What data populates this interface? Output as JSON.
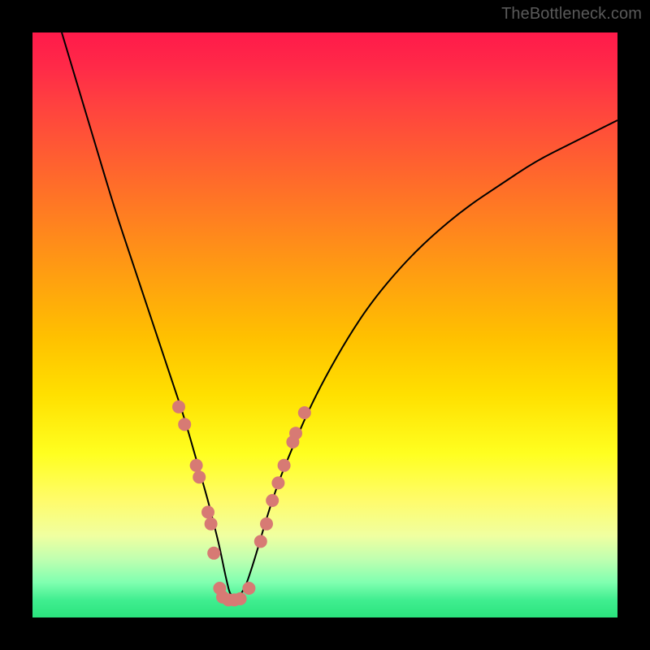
{
  "watermark": {
    "text": "TheBottleneck.com"
  },
  "chart_data": {
    "type": "line",
    "title": "",
    "xlabel": "",
    "ylabel": "",
    "xlim": [
      0,
      100
    ],
    "ylim": [
      0,
      100
    ],
    "series": [
      {
        "name": "bottleneck-curve",
        "x": [
          5,
          8,
          11,
          14,
          17,
          20,
          22,
          24,
          26,
          28,
          30,
          31,
          32,
          33,
          34,
          36,
          38,
          40,
          42,
          44,
          47,
          50,
          54,
          58,
          63,
          68,
          74,
          80,
          86,
          92,
          100
        ],
        "y": [
          100,
          90,
          80,
          70,
          61,
          52,
          46,
          40,
          34,
          27,
          20,
          16,
          12,
          7,
          3,
          4,
          10,
          17,
          23,
          28,
          35,
          41,
          48,
          54,
          60,
          65,
          70,
          74,
          78,
          81,
          85
        ]
      }
    ],
    "markers": {
      "name": "highlight-dots",
      "color": "#d77a74",
      "radius": 8,
      "points": [
        {
          "x": 25,
          "y": 36
        },
        {
          "x": 26,
          "y": 33
        },
        {
          "x": 28,
          "y": 26
        },
        {
          "x": 28.5,
          "y": 24
        },
        {
          "x": 30,
          "y": 18
        },
        {
          "x": 30.5,
          "y": 16
        },
        {
          "x": 31,
          "y": 11
        },
        {
          "x": 32,
          "y": 5
        },
        {
          "x": 32.5,
          "y": 3.5
        },
        {
          "x": 33.5,
          "y": 3
        },
        {
          "x": 34.5,
          "y": 3
        },
        {
          "x": 35.5,
          "y": 3.2
        },
        {
          "x": 37,
          "y": 5
        },
        {
          "x": 39,
          "y": 13
        },
        {
          "x": 40,
          "y": 16
        },
        {
          "x": 41,
          "y": 20
        },
        {
          "x": 42,
          "y": 23
        },
        {
          "x": 43,
          "y": 26
        },
        {
          "x": 44.5,
          "y": 30
        },
        {
          "x": 45,
          "y": 31.5
        },
        {
          "x": 46.5,
          "y": 35
        }
      ]
    }
  }
}
